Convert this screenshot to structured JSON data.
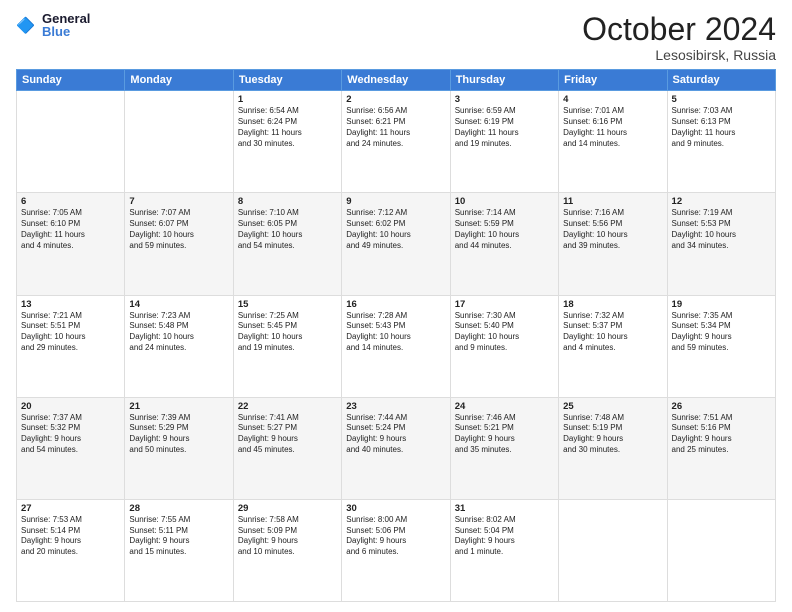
{
  "header": {
    "logo_general": "General",
    "logo_blue": "Blue",
    "month": "October 2024",
    "location": "Lesosibirsk, Russia"
  },
  "weekdays": [
    "Sunday",
    "Monday",
    "Tuesday",
    "Wednesday",
    "Thursday",
    "Friday",
    "Saturday"
  ],
  "weeks": [
    [
      {
        "day": "",
        "info": ""
      },
      {
        "day": "",
        "info": ""
      },
      {
        "day": "1",
        "info": "Sunrise: 6:54 AM\nSunset: 6:24 PM\nDaylight: 11 hours\nand 30 minutes."
      },
      {
        "day": "2",
        "info": "Sunrise: 6:56 AM\nSunset: 6:21 PM\nDaylight: 11 hours\nand 24 minutes."
      },
      {
        "day": "3",
        "info": "Sunrise: 6:59 AM\nSunset: 6:19 PM\nDaylight: 11 hours\nand 19 minutes."
      },
      {
        "day": "4",
        "info": "Sunrise: 7:01 AM\nSunset: 6:16 PM\nDaylight: 11 hours\nand 14 minutes."
      },
      {
        "day": "5",
        "info": "Sunrise: 7:03 AM\nSunset: 6:13 PM\nDaylight: 11 hours\nand 9 minutes."
      }
    ],
    [
      {
        "day": "6",
        "info": "Sunrise: 7:05 AM\nSunset: 6:10 PM\nDaylight: 11 hours\nand 4 minutes."
      },
      {
        "day": "7",
        "info": "Sunrise: 7:07 AM\nSunset: 6:07 PM\nDaylight: 10 hours\nand 59 minutes."
      },
      {
        "day": "8",
        "info": "Sunrise: 7:10 AM\nSunset: 6:05 PM\nDaylight: 10 hours\nand 54 minutes."
      },
      {
        "day": "9",
        "info": "Sunrise: 7:12 AM\nSunset: 6:02 PM\nDaylight: 10 hours\nand 49 minutes."
      },
      {
        "day": "10",
        "info": "Sunrise: 7:14 AM\nSunset: 5:59 PM\nDaylight: 10 hours\nand 44 minutes."
      },
      {
        "day": "11",
        "info": "Sunrise: 7:16 AM\nSunset: 5:56 PM\nDaylight: 10 hours\nand 39 minutes."
      },
      {
        "day": "12",
        "info": "Sunrise: 7:19 AM\nSunset: 5:53 PM\nDaylight: 10 hours\nand 34 minutes."
      }
    ],
    [
      {
        "day": "13",
        "info": "Sunrise: 7:21 AM\nSunset: 5:51 PM\nDaylight: 10 hours\nand 29 minutes."
      },
      {
        "day": "14",
        "info": "Sunrise: 7:23 AM\nSunset: 5:48 PM\nDaylight: 10 hours\nand 24 minutes."
      },
      {
        "day": "15",
        "info": "Sunrise: 7:25 AM\nSunset: 5:45 PM\nDaylight: 10 hours\nand 19 minutes."
      },
      {
        "day": "16",
        "info": "Sunrise: 7:28 AM\nSunset: 5:43 PM\nDaylight: 10 hours\nand 14 minutes."
      },
      {
        "day": "17",
        "info": "Sunrise: 7:30 AM\nSunset: 5:40 PM\nDaylight: 10 hours\nand 9 minutes."
      },
      {
        "day": "18",
        "info": "Sunrise: 7:32 AM\nSunset: 5:37 PM\nDaylight: 10 hours\nand 4 minutes."
      },
      {
        "day": "19",
        "info": "Sunrise: 7:35 AM\nSunset: 5:34 PM\nDaylight: 9 hours\nand 59 minutes."
      }
    ],
    [
      {
        "day": "20",
        "info": "Sunrise: 7:37 AM\nSunset: 5:32 PM\nDaylight: 9 hours\nand 54 minutes."
      },
      {
        "day": "21",
        "info": "Sunrise: 7:39 AM\nSunset: 5:29 PM\nDaylight: 9 hours\nand 50 minutes."
      },
      {
        "day": "22",
        "info": "Sunrise: 7:41 AM\nSunset: 5:27 PM\nDaylight: 9 hours\nand 45 minutes."
      },
      {
        "day": "23",
        "info": "Sunrise: 7:44 AM\nSunset: 5:24 PM\nDaylight: 9 hours\nand 40 minutes."
      },
      {
        "day": "24",
        "info": "Sunrise: 7:46 AM\nSunset: 5:21 PM\nDaylight: 9 hours\nand 35 minutes."
      },
      {
        "day": "25",
        "info": "Sunrise: 7:48 AM\nSunset: 5:19 PM\nDaylight: 9 hours\nand 30 minutes."
      },
      {
        "day": "26",
        "info": "Sunrise: 7:51 AM\nSunset: 5:16 PM\nDaylight: 9 hours\nand 25 minutes."
      }
    ],
    [
      {
        "day": "27",
        "info": "Sunrise: 7:53 AM\nSunset: 5:14 PM\nDaylight: 9 hours\nand 20 minutes."
      },
      {
        "day": "28",
        "info": "Sunrise: 7:55 AM\nSunset: 5:11 PM\nDaylight: 9 hours\nand 15 minutes."
      },
      {
        "day": "29",
        "info": "Sunrise: 7:58 AM\nSunset: 5:09 PM\nDaylight: 9 hours\nand 10 minutes."
      },
      {
        "day": "30",
        "info": "Sunrise: 8:00 AM\nSunset: 5:06 PM\nDaylight: 9 hours\nand 6 minutes."
      },
      {
        "day": "31",
        "info": "Sunrise: 8:02 AM\nSunset: 5:04 PM\nDaylight: 9 hours\nand 1 minute."
      },
      {
        "day": "",
        "info": ""
      },
      {
        "day": "",
        "info": ""
      }
    ]
  ]
}
